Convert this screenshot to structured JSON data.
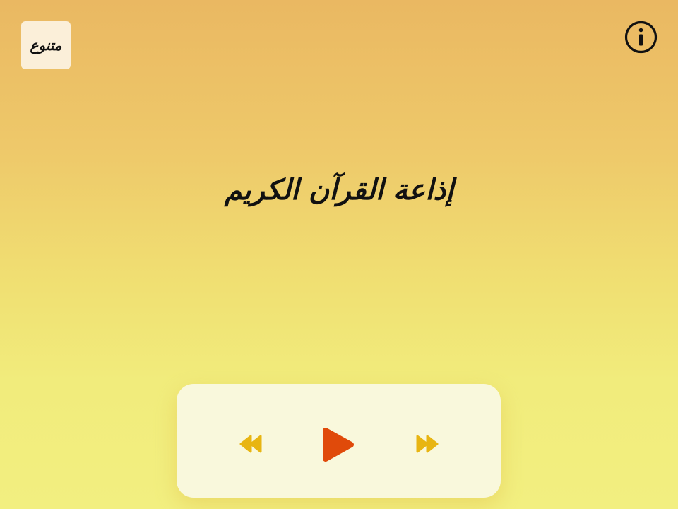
{
  "station": {
    "label": "متنوع"
  },
  "title": "إذاعة القرآن الكريم",
  "colors": {
    "background_top": "#eab862",
    "background_bottom": "#f2ef80",
    "player_card": "#f9f8dc",
    "play_accent": "#e04a0a",
    "skip_accent": "#e8b512",
    "station_button": "#fbefd9"
  },
  "icons": {
    "info": "info-circle-icon",
    "rewind": "rewind-icon",
    "play": "play-icon",
    "forward": "fast-forward-icon"
  }
}
